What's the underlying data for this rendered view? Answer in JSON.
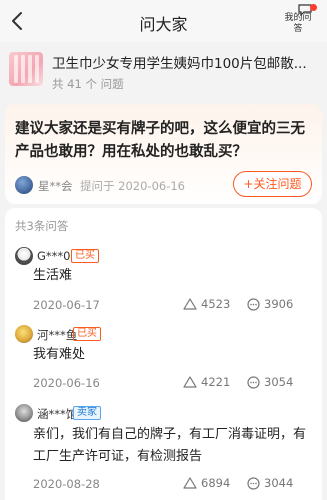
{
  "header": {
    "title": "问大家",
    "my_questions_label": "我的问答",
    "back_icon": "chevron-left-icon"
  },
  "product": {
    "title": "卫生巾少女专用学生姨妈巾100片包邮散...",
    "count_text": "共 41 个 问题"
  },
  "question": {
    "text": "建议大家还是买有牌子的吧，这么便宜的三无产品也敢用？用在私处的也敢乱买？",
    "asker": "星**会",
    "asked_date": "提问于 2020-06-16",
    "follow_label": "+关注问题"
  },
  "answers_header": "共3条问答",
  "answers": [
    {
      "user": "G***0",
      "badge": "已买",
      "text": "生活难",
      "date": "2020-06-17",
      "likes": "4523",
      "comments": "3906"
    },
    {
      "user": "河***鱼",
      "badge": "已买",
      "text": "我有难处",
      "date": "2020-06-16",
      "likes": "4221",
      "comments": "3054"
    },
    {
      "user": "涵***馆",
      "badge": "卖家",
      "text": "亲们，我们有自己的牌子，有工厂消毒证明，有工厂生产许可证，有检测报告",
      "date": "2020-08-28",
      "likes": "6894",
      "comments": "3044"
    }
  ],
  "colors": {
    "accent": "#ff5a1f",
    "seller_badge": "#1e7bd8",
    "notification_dot": "#ff3b30"
  }
}
